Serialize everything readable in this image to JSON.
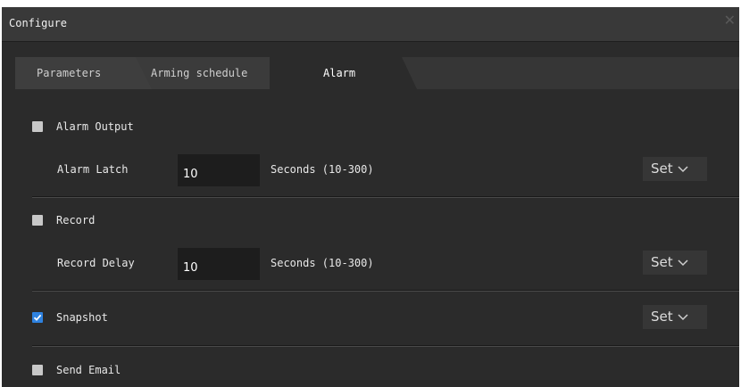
{
  "window": {
    "title": "Configure",
    "close_icon": "close-icon"
  },
  "tabs": [
    {
      "label": "Parameters",
      "active": false
    },
    {
      "label": "Arming schedule",
      "active": false
    },
    {
      "label": "Alarm",
      "active": true
    }
  ],
  "alarm_output": {
    "label": "Alarm Output",
    "checked": false,
    "latch_label": "Alarm Latch",
    "latch_value": "10",
    "unit": "Seconds (10-300)",
    "set_label": "Set"
  },
  "record": {
    "label": "Record",
    "checked": false,
    "delay_label": "Record Delay",
    "delay_value": "10",
    "unit": "Seconds (10-300)",
    "set_label": "Set"
  },
  "snapshot": {
    "label": "Snapshot",
    "checked": true,
    "set_label": "Set"
  },
  "send_email": {
    "label": "Send Email",
    "checked": false
  },
  "colors": {
    "background": "#2b2b2b",
    "titlebar": "#393939",
    "input_bg": "#1d1d1d",
    "checkbox_checked": "#2e82e0",
    "checkbox_unchecked": "#c8c8c8"
  }
}
